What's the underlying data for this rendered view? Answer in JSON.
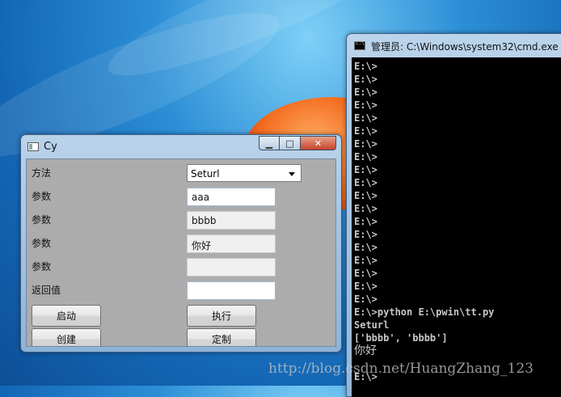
{
  "cy_window": {
    "title": "Cy",
    "method_label": "方法",
    "method_value": "Seturl",
    "params": [
      {
        "label": "参数",
        "value": "aaa"
      },
      {
        "label": "参数",
        "value": "bbbb"
      },
      {
        "label": "参数",
        "value": "你好"
      },
      {
        "label": "参数",
        "value": ""
      }
    ],
    "return_label": "返回值",
    "return_value": "",
    "buttons": {
      "start": "启动",
      "execute": "执行",
      "create": "创建",
      "customize": "定制"
    }
  },
  "cmd_window": {
    "title": "管理员: C:\\Windows\\system32\\cmd.exe",
    "lines": [
      "E:\\>",
      "E:\\>",
      "E:\\>",
      "E:\\>",
      "E:\\>",
      "E:\\>",
      "E:\\>",
      "E:\\>",
      "E:\\>",
      "E:\\>",
      "E:\\>",
      "E:\\>",
      "E:\\>",
      "E:\\>",
      "E:\\>",
      "E:\\>",
      "E:\\>",
      "E:\\>",
      "E:\\>",
      "E:\\>python E:\\pwin\\tt.py",
      "Seturl",
      "['bbbb', 'bbbb']",
      "你好",
      "",
      "E:\\>"
    ]
  },
  "watermark": "http://blog.csdn.net/HuangZhang_123",
  "colors": {
    "console_bg": "#000000",
    "console_text": "#c8c8c8",
    "client_bg": "#acacac"
  }
}
